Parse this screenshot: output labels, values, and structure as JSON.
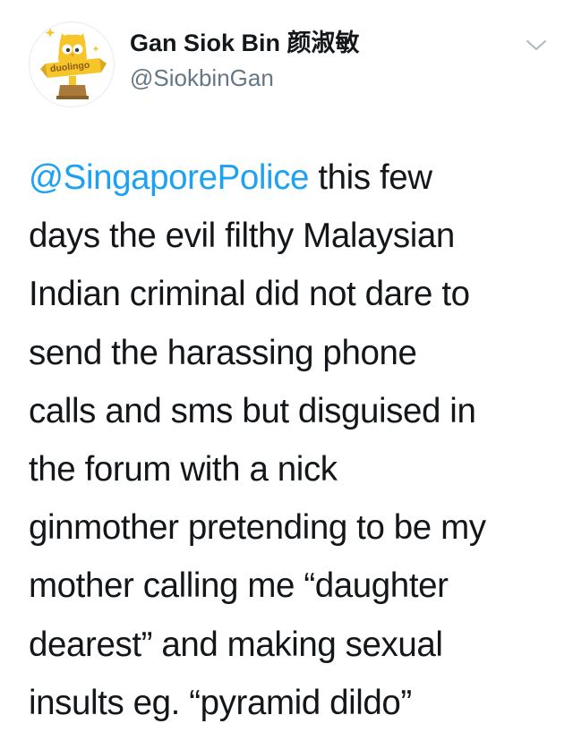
{
  "user": {
    "display_name": "Gan Siok Bin 颜淑敏",
    "handle": "@SiokbinGan",
    "avatar_badge_text": "duolingo",
    "avatar_icon": "duolingo-owl-trophy-avatar"
  },
  "menu": {
    "icon": "chevron-down-icon"
  },
  "tweet": {
    "mention": "@SingaporePolice",
    "lines": [
      " this few",
      "days the evil filthy Malaysian",
      "Indian criminal did not dare to",
      "send the harassing phone",
      "calls and sms but disguised in",
      "the forum with a nick",
      "ginmother pretending to be my",
      "mother calling me “daughter",
      "dearest” and making sexual",
      "insults eg. “pyramid dildo”"
    ]
  },
  "colors": {
    "mention": "#1da1f2",
    "handle": "#657786",
    "text": "#14171a",
    "avatar_yellow": "#f6c52a",
    "avatar_brown": "#a97a3a"
  }
}
